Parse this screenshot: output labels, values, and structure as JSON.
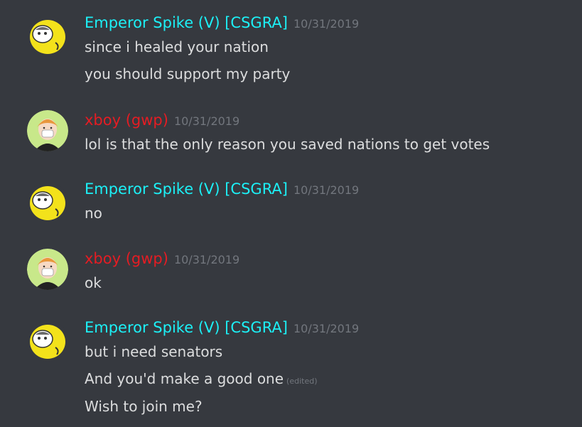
{
  "colors": {
    "background": "#36393f",
    "message_text": "#dcddde",
    "timestamp": "#72767d",
    "spike_name": "#1cf0f6",
    "xboy_name": "#e51c23"
  },
  "messages": [
    {
      "author": "Emperor Spike (V) [CSGRA]",
      "timestamp": "10/31/2019",
      "lines": [
        "since i healed your nation",
        "you should support my party"
      ]
    },
    {
      "author": "xboy (gwp)",
      "timestamp": "10/31/2019",
      "lines": [
        "lol is that the only reason you saved nations to get votes"
      ]
    },
    {
      "author": "Emperor Spike (V) [CSGRA]",
      "timestamp": "10/31/2019",
      "lines": [
        "no"
      ]
    },
    {
      "author": "xboy (gwp)",
      "timestamp": "10/31/2019",
      "lines": [
        "ok"
      ]
    },
    {
      "author": "Emperor Spike (V) [CSGRA]",
      "timestamp": "10/31/2019",
      "lines": [
        "but i need senators",
        "And you'd make a good one",
        "Wish to join me?"
      ],
      "edited_label": "(edited)"
    }
  ]
}
